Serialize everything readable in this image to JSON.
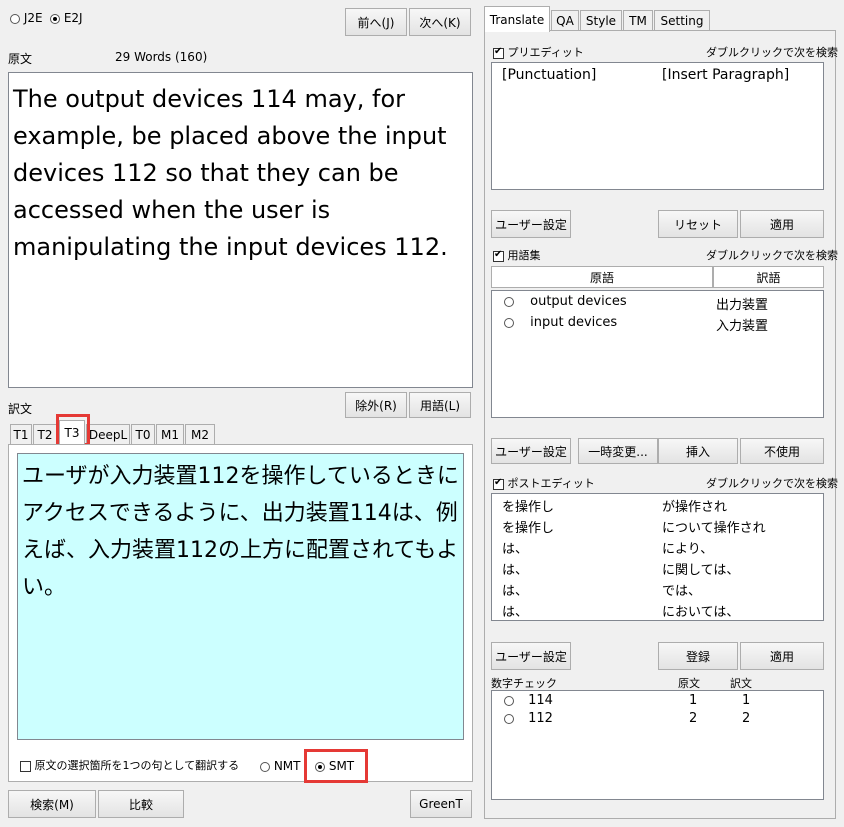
{
  "top": {
    "j2e_label": "J2E",
    "e2j_label": "E2J",
    "prev_button": "前へ(J)",
    "next_button": "次へ(K)"
  },
  "source": {
    "label": "原文",
    "word_count": "29 Words (160)",
    "text": "The output devices 114 may, for example, be placed above the input devices 112 so that they can be accessed when the user is manipulating the input devices 112."
  },
  "middle": {
    "exclude_button": "除外(R)",
    "terms_button": "用語(L)"
  },
  "translation": {
    "label": "訳文",
    "tabs": [
      "T1",
      "T2",
      "T3",
      "DeepL",
      "T0",
      "M1",
      "M2"
    ],
    "text": "ユーザが入力装置112を操作しているときにアクセスできるように、出力装置114は、例えば、入力装置112の上方に配置されてもよい。",
    "checkbox_label": "原文の選択箇所を1つの句として翻訳する",
    "nmt_label": "NMT",
    "smt_label": "SMT"
  },
  "bottom": {
    "search_button": "検索(M)",
    "compare_button": "比較",
    "greent_button": "GreenT"
  },
  "right_tabs": [
    "Translate",
    "QA",
    "Style",
    "TM",
    "Setting"
  ],
  "pre_edit": {
    "checkbox_label": "プリエディット",
    "hint": "ダブルクリックで次を検索",
    "items": [
      {
        "left": "[Punctuation]",
        "right": "[Insert Paragraph]"
      }
    ],
    "user_settings_button": "ユーザー設定",
    "reset_button": "リセット",
    "apply_button": "適用"
  },
  "glossary": {
    "checkbox_label": "用語集",
    "hint": "ダブルクリックで次を検索",
    "col_source": "原語",
    "col_target": "訳語",
    "rows": [
      {
        "source": "output devices",
        "target": "出力装置"
      },
      {
        "source": "input devices",
        "target": "入力装置"
      }
    ],
    "user_settings_button": "ユーザー設定",
    "temp_change_button": "一時変更...",
    "insert_button": "挿入",
    "unused_button": "不使用"
  },
  "post_edit": {
    "checkbox_label": "ポストエディット",
    "hint": "ダブルクリックで次を検索",
    "rows": [
      {
        "left": "を操作し",
        "right": "が操作され"
      },
      {
        "left": "を操作し",
        "right": "について操作され"
      },
      {
        "left": "は、",
        "right": "により、"
      },
      {
        "left": "は、",
        "right": "に関しては、"
      },
      {
        "left": "は、",
        "right": "では、"
      },
      {
        "left": "は、",
        "right": "においては、"
      }
    ],
    "user_settings_button": "ユーザー設定",
    "register_button": "登録",
    "apply_button": "適用"
  },
  "number_check": {
    "label": "数字チェック",
    "col_source": "原文",
    "col_target": "訳文",
    "rows": [
      {
        "number": "114",
        "source": "1",
        "target": "1"
      },
      {
        "number": "112",
        "source": "2",
        "target": "2"
      }
    ]
  }
}
